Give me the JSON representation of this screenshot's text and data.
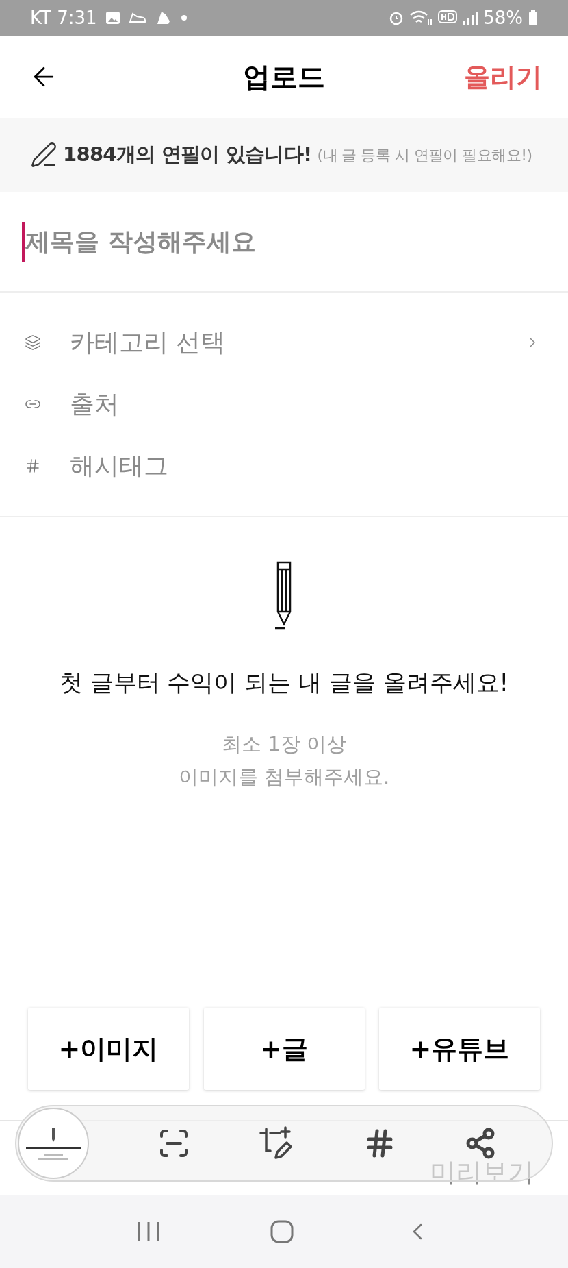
{
  "status_bar": {
    "carrier_time": "KT 7:31",
    "battery": "58%"
  },
  "header": {
    "title": "업로드",
    "action": "올리기"
  },
  "notice": {
    "text": "1884개의 연필이 있습니다!",
    "note": "(내 글 등록 시 연필이 필요해요!)"
  },
  "title_field": {
    "placeholder": "제목을 작성해주세요"
  },
  "options": [
    {
      "kind": "category",
      "label": "카테고리 선택",
      "has_chevron": true
    },
    {
      "kind": "source",
      "label": "출처",
      "has_chevron": false
    },
    {
      "kind": "hashtag",
      "label": "해시태그",
      "has_chevron": false
    }
  ],
  "empty_state": {
    "headline": "첫 글부터 수익이 되는 내 글을 올려주세요!",
    "hint_lines": [
      "최소 1장 이상",
      "이미지를 첨부해주세요."
    ]
  },
  "add_buttons": [
    "+이미지",
    "+글",
    "+유튜브"
  ],
  "preview_label": "미리보기"
}
